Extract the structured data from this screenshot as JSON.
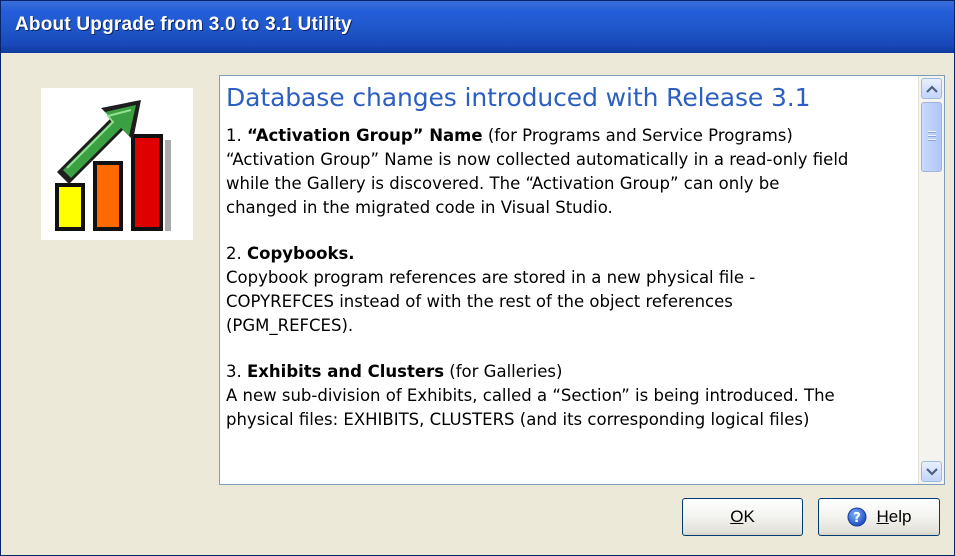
{
  "window": {
    "title": "About Upgrade from 3.0 to 3.1 Utility"
  },
  "logo": {
    "icon": "upgrade-bar-chart-arrow-icon",
    "colors": {
      "bar_yellow": "#ffff00",
      "bar_orange": "#ff6a00",
      "bar_red": "#e00000",
      "arrow_green": "#3aa041"
    }
  },
  "content": {
    "heading": "Database changes introduced with Release 3.1",
    "sections": [
      {
        "number": "1.",
        "title": "“Activation Group” Name",
        "subtitle": "(for Programs and Service Programs)",
        "lines": [
          "“Activation Group” Name is now collected automatically in a read-only field",
          "while the Gallery is discovered. The “Activation Group” can only be",
          "changed in the migrated code in Visual Studio."
        ]
      },
      {
        "number": "2.",
        "title": "Copybooks.",
        "subtitle": "",
        "lines": [
          "Copybook program references are stored in a new physical file -",
          "COPYREFCES instead of with the rest of the object references",
          "(PGM_REFCES)."
        ]
      },
      {
        "number": "3.",
        "title": "Exhibits and Clusters",
        "subtitle": "(for Galleries)",
        "lines": [
          "A new sub-division of Exhibits, called a “Section” is being introduced. The",
          "physical files:  EXHIBITS, CLUSTERS (and its corresponding logical files)"
        ]
      }
    ]
  },
  "buttons": {
    "ok_label": "OK",
    "ok_mnemonic": "O",
    "ok_rest": "K",
    "help_label": "Help",
    "help_mnemonic": "H",
    "help_rest": "elp"
  },
  "colors": {
    "titlebar": "#245edb",
    "heading": "#2c5fc0",
    "dialog_bg": "#ece9d8"
  }
}
